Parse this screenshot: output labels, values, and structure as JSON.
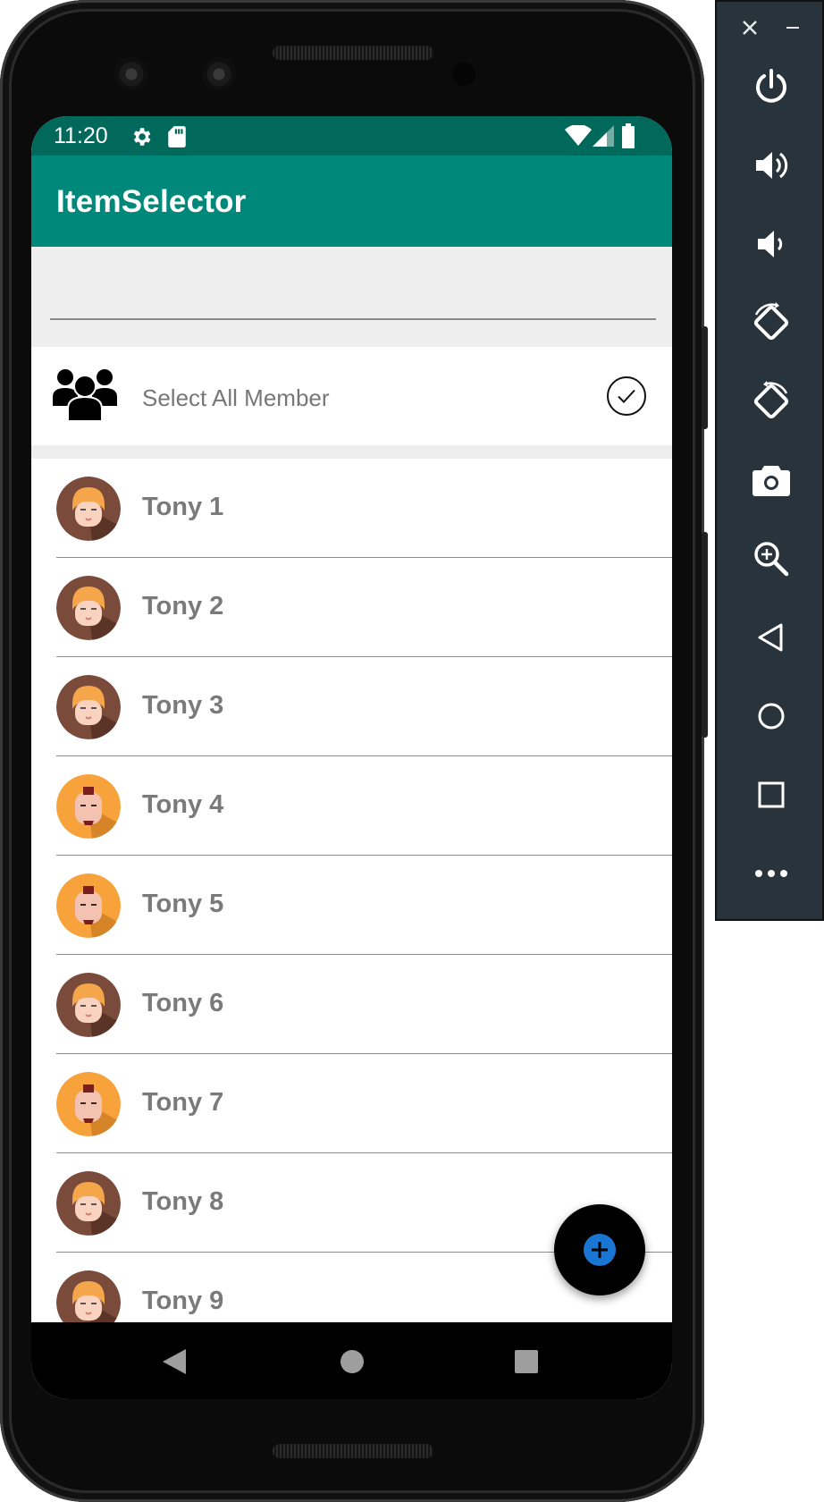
{
  "status_bar": {
    "time": "11:20"
  },
  "app_bar": {
    "title": "ItemSelector"
  },
  "search": {
    "value": "",
    "placeholder": ""
  },
  "select_all": {
    "label": "Select All Member"
  },
  "members": [
    {
      "name": "Tony 1",
      "avatar": "brown"
    },
    {
      "name": "Tony 2",
      "avatar": "brown"
    },
    {
      "name": "Tony 3",
      "avatar": "brown"
    },
    {
      "name": "Tony 4",
      "avatar": "orange"
    },
    {
      "name": "Tony 5",
      "avatar": "orange"
    },
    {
      "name": "Tony 6",
      "avatar": "brown"
    },
    {
      "name": "Tony 7",
      "avatar": "orange"
    },
    {
      "name": "Tony 8",
      "avatar": "brown"
    },
    {
      "name": "Tony 9",
      "avatar": "brown"
    }
  ],
  "colors": {
    "status_bar": "#00695c",
    "app_bar": "#00897b",
    "fab": "#000000",
    "fab_icon": "#1976d2",
    "toolbar": "#29333b"
  },
  "icons": {
    "group": "group-icon",
    "check": "check-circle-icon",
    "fab": "add-icon",
    "emulator_toolbar": [
      "close-icon",
      "minimize-icon",
      "power-icon",
      "volume-up-icon",
      "volume-down-icon",
      "rotate-left-icon",
      "rotate-right-icon",
      "camera-icon",
      "zoom-icon",
      "back-icon",
      "home-icon",
      "overview-icon",
      "more-icon"
    ]
  }
}
